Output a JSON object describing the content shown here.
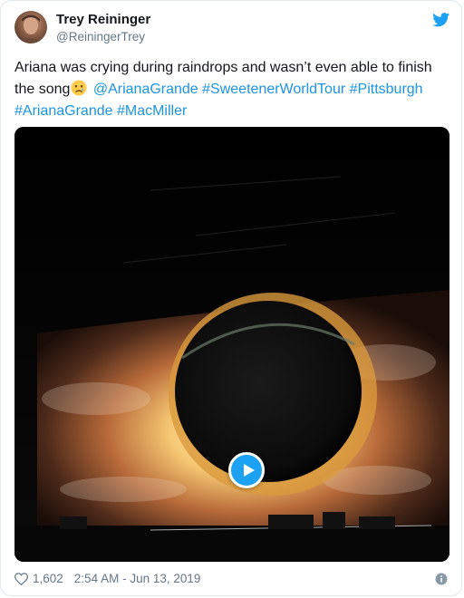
{
  "author": {
    "name": "Trey Reininger",
    "handle": "@ReiningerTrey"
  },
  "tweet": {
    "text_part1": "Ariana was crying during raindrops and wasn’t even able to finish the song",
    "emoji": "crying-face",
    "mention": "@ArianaGrande",
    "hashtags": [
      "#SweetenerWorldTour",
      "#Pittsburgh",
      "#ArianaGrande",
      "#MacMiller"
    ]
  },
  "footer": {
    "likes": "1,602",
    "timestamp": "2:54 AM - Jun 13, 2019"
  },
  "colors": {
    "link": "#1b95e0",
    "brand": "#1da1f2",
    "secondary_text": "#657786"
  },
  "icons": {
    "brand": "twitter-bird-icon",
    "like": "heart-icon",
    "info": "info-icon",
    "play": "play-icon"
  }
}
